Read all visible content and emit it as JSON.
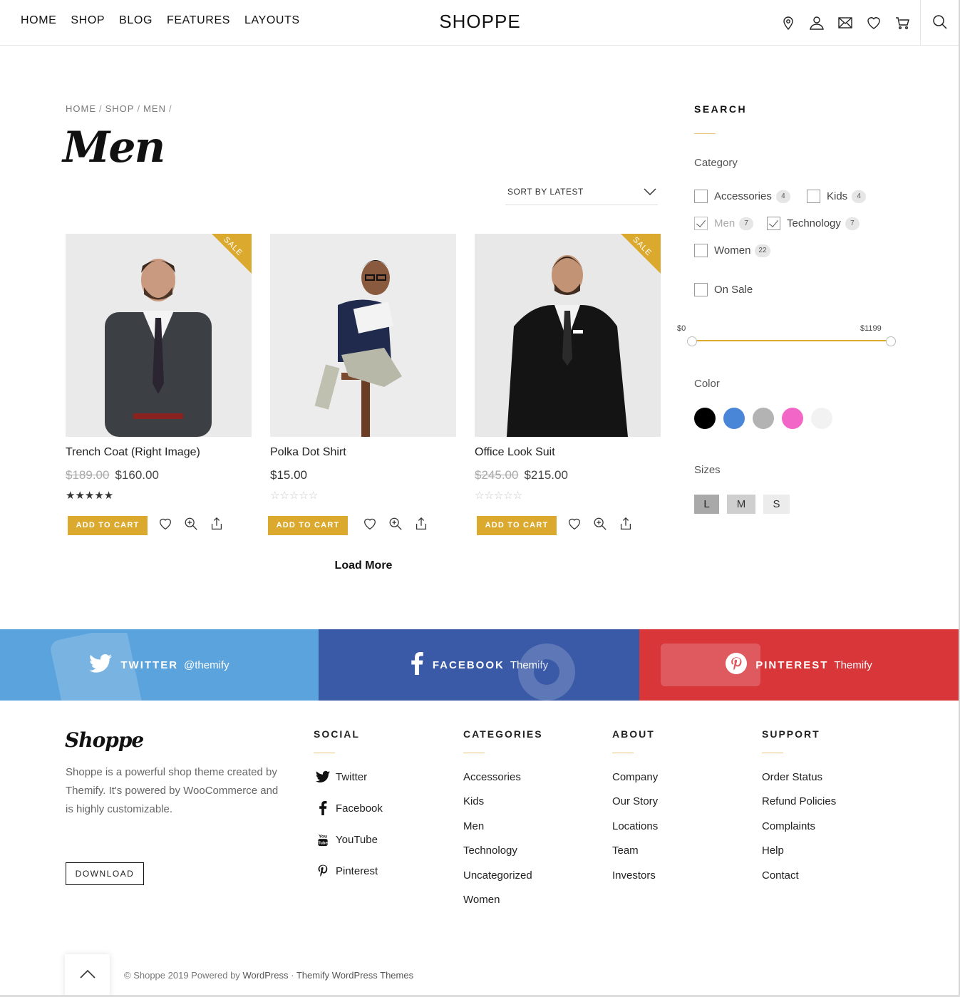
{
  "header": {
    "nav": [
      "HOME",
      "SHOP",
      "BLOG",
      "FEATURES",
      "LAYOUTS"
    ],
    "logo": "SHOPPE",
    "icons": [
      "location-icon",
      "user-icon",
      "mail-icon",
      "heart-icon",
      "cart-icon",
      "search-icon"
    ]
  },
  "breadcrumb": [
    "HOME",
    "SHOP",
    "MEN"
  ],
  "page_title": "Men",
  "sort": {
    "label": "SORT BY LATEST"
  },
  "products": [
    {
      "name": "Trench Coat (Right Image)",
      "old_price": "$189.00",
      "price": "$160.00",
      "sale": "SALE",
      "rating": 5,
      "button": "ADD TO CART"
    },
    {
      "name": "Polka Dot Shirt",
      "old_price": "",
      "price": "$15.00",
      "sale": "",
      "rating": 0,
      "button": "ADD TO CART"
    },
    {
      "name": "Office Look Suit",
      "old_price": "$245.00",
      "price": "$215.00",
      "sale": "SALE",
      "rating": 0,
      "button": "ADD TO CART"
    }
  ],
  "load_more": "Load More",
  "sidebar": {
    "title": "SEARCH",
    "category_heading": "Category",
    "categories": [
      {
        "label": "Accessories",
        "count": "4",
        "checked": false
      },
      {
        "label": "Kids",
        "count": "4",
        "checked": false
      },
      {
        "label": "Men",
        "count": "7",
        "checked": true
      },
      {
        "label": "Technology",
        "count": "7",
        "checked": true
      },
      {
        "label": "Women",
        "count": "22",
        "checked": false
      }
    ],
    "on_sale": "On Sale",
    "price_min": "$0",
    "price_max": "$1199",
    "color_heading": "Color",
    "colors": [
      "#000000",
      "#4a86d8",
      "#b3b3b3",
      "#f266c8",
      "#f2f2f2"
    ],
    "sizes_heading": "Sizes",
    "sizes": [
      "L",
      "M",
      "S"
    ]
  },
  "social_bar": [
    {
      "label": "TWITTER",
      "handle": "@themify",
      "color": "#5aa3dc"
    },
    {
      "label": "FACEBOOK",
      "handle": "Themify",
      "color": "#3a5aa8"
    },
    {
      "label": "PINTEREST",
      "handle": "Themify",
      "color": "#d9363a"
    }
  ],
  "footer": {
    "logo": "Shoppe",
    "description": "Shoppe is a powerful shop theme created by Themify. It's powered by WooCommerce and is highly customizable.",
    "download": "DOWNLOAD",
    "social_title": "SOCIAL",
    "social_links": [
      "Twitter",
      "Facebook",
      "YouTube",
      "Pinterest"
    ],
    "categories_title": "CATEGORIES",
    "categories": [
      "Accessories",
      "Kids",
      "Men",
      "Technology",
      "Uncategorized",
      "Women"
    ],
    "about_title": "ABOUT",
    "about": [
      "Company",
      "Our Story",
      "Locations",
      "Team",
      "Investors"
    ],
    "support_title": "SUPPORT",
    "support": [
      "Order Status",
      "Refund Policies",
      "Complaints",
      "Help",
      "Contact"
    ],
    "copyright_prefix": "© Shoppe 2019 Powered by",
    "wordpress": "WordPress",
    "separator": "·",
    "themes": "Themify WordPress Themes"
  },
  "accent_color": "#dca92f"
}
